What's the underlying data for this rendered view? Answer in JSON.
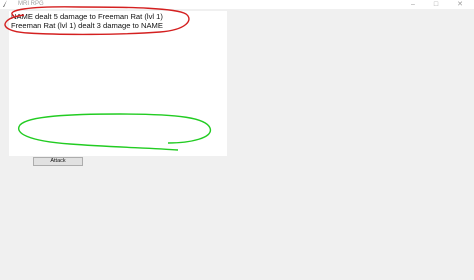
{
  "window": {
    "title": "MRI RPG",
    "icon": "feather-icon",
    "controls": [
      "minimize-icon",
      "maximize-icon",
      "close-icon"
    ]
  },
  "log": {
    "lines": [
      "NAME dealt 5 damage to Freeman Rat (lvl 1)",
      "Freeman Rat (lvl 1) dealt 3 damage to NAME"
    ]
  },
  "controls": {
    "attack_label": "Attack"
  },
  "annotations": {
    "red_circle_color": "#d42020",
    "green_loop_color": "#22cc22"
  }
}
